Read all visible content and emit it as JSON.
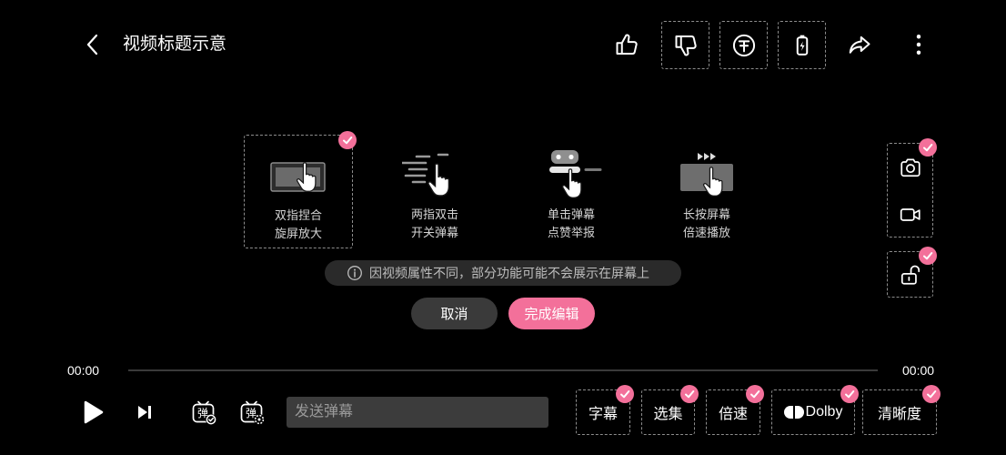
{
  "header": {
    "title": "视频标题示意",
    "back_icon": "chevron-left-icon",
    "actions": [
      {
        "icon": "thumbs-up-icon"
      },
      {
        "icon": "thumbs-down-icon"
      },
      {
        "icon": "coin-icon"
      },
      {
        "icon": "battery-charging-icon"
      },
      {
        "icon": "share-icon"
      },
      {
        "icon": "more-vertical-icon"
      }
    ]
  },
  "gestures": [
    {
      "line1": "双指捏合",
      "line2": "旋屏放大",
      "icon": "pinch-zoom-gesture-icon",
      "selected": true
    },
    {
      "line1": "两指双击",
      "line2": "开关弹幕",
      "icon": "double-tap-gesture-icon",
      "selected": false
    },
    {
      "line1": "单击弹幕",
      "line2": "点赞举报",
      "icon": "tap-danmaku-gesture-icon",
      "selected": false
    },
    {
      "line1": "长按屏幕",
      "line2": "倍速播放",
      "icon": "long-press-gesture-icon",
      "selected": false
    }
  ],
  "side_tools": [
    {
      "icon": "camera-icon",
      "selected": true
    },
    {
      "icon": "video-record-icon",
      "selected": true
    },
    {
      "icon": "unlock-icon",
      "selected": true
    }
  ],
  "notice": {
    "icon": "info-icon",
    "text": "因视频属性不同，部分功能可能不会展示在屏幕上"
  },
  "edit_actions": {
    "cancel": "取消",
    "done": "完成编辑"
  },
  "player": {
    "time_current": "00:00",
    "time_total": "00:00",
    "progress": 0,
    "danmaku_glyph": "弹",
    "danmaku_placeholder": "发送弹幕"
  },
  "controls": [
    {
      "label": "字幕",
      "selected": true
    },
    {
      "label": "选集",
      "selected": true
    },
    {
      "label": "倍速",
      "selected": true
    },
    {
      "label": "Dolby",
      "icon": "dolby-logo-icon",
      "selected": true
    },
    {
      "label": "清晰度",
      "selected": true
    }
  ],
  "colors": {
    "background": "#000000",
    "accent": "#f3709a",
    "notice_bg": "#2a2a2a",
    "cancel_bg": "#3a3a3a",
    "input_bg": "#3c3c3c",
    "text_muted": "#bdbdbd"
  }
}
